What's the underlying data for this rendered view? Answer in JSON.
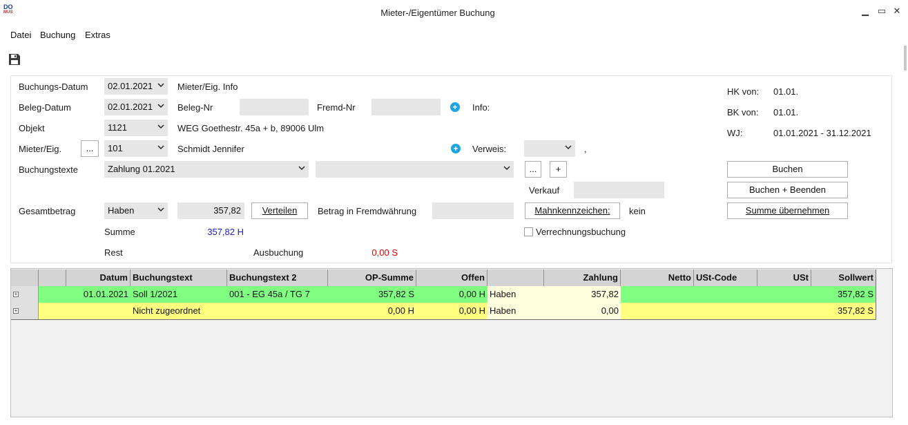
{
  "window": {
    "title": "Mieter-/Eigentümer Buchung",
    "logo_top": "DO",
    "logo_bottom": "MUS",
    "minimize": "▁",
    "maximize": "▭",
    "close": "✕"
  },
  "menu": {
    "datei": "Datei",
    "buchung": "Buchung",
    "extras": "Extras"
  },
  "form": {
    "buchungs_datum_label": "Buchungs-Datum",
    "buchungs_datum_value": "02.01.2021",
    "mieter_info_label": "Mieter/Eig. Info",
    "beleg_datum_label": "Beleg-Datum",
    "beleg_datum_value": "02.01.2021",
    "beleg_nr_label": "Beleg-Nr",
    "fremd_nr_label": "Fremd-Nr",
    "info_label": "Info:",
    "objekt_label": "Objekt",
    "objekt_value": "1121",
    "objekt_name": "WEG Goethestr. 45a + b, 89006 Ulm",
    "mieter_label": "Mieter/Eig.",
    "mieter_dots": "...",
    "mieter_value": "101",
    "mieter_name": "Schmidt Jennifer",
    "verweis_label": "Verweis:",
    "verweis_comma": ",",
    "buchungstexte_label": "Buchungstexte",
    "buchungstext1_value": "Zahlung 01.2021",
    "buchungstext2_value": "",
    "dots_button": "...",
    "plus_button": "+",
    "verkauf_label": "Verkauf",
    "gesamtbetrag_label": "Gesamtbetrag",
    "soll_haben_value": "Haben",
    "betrag_value": "357,82",
    "verteilen_button": "Verteilen",
    "fremdwaehrung_label": "Betrag in Fremdwährung",
    "mahnkennzeichen_button": "Mahnkennzeichen:",
    "mahnkennzeichen_value": "kein",
    "summe_label": "Summe",
    "summe_value": "357,82 H",
    "verrechnung_label": "Verrechnungsbuchung",
    "rest_label": "Rest",
    "ausbuchung_label": "Ausbuchung",
    "ausbuchung_value": "0,00 S"
  },
  "info_panel": {
    "hk_label": "HK von:",
    "hk_value": "01.01.",
    "bk_label": "BK von:",
    "bk_value": "01.01.",
    "wj_label": "WJ:",
    "wj_value": "01.01.2021 - 31.12.2021"
  },
  "actions": {
    "buchen": "Buchen",
    "buchen_beenden": "Buchen + Beenden",
    "summe_uebernehmen": "Summe übernehmen"
  },
  "grid": {
    "headers": [
      "Datum",
      "Buchungstext",
      "Buchungstext 2",
      "OP-Summe",
      "Offen",
      "",
      "Zahlung",
      "Netto",
      "USt-Code",
      "USt",
      "Sollwert"
    ],
    "rows": [
      {
        "datum": "01.01.2021",
        "text": "Soll 1/2021",
        "text2": "001 - EG  45a / TG 7",
        "op": "357,82 S",
        "offen": "0,00 H",
        "sh": "Haben",
        "zahlung": "357,82",
        "netto": "",
        "ustcode": "",
        "ust": "",
        "soll": "357,82 S"
      },
      {
        "datum": "",
        "text": "Nicht zugeordnet",
        "text2": "",
        "op": "0,00 H",
        "offen": "0,00 H",
        "sh": "Haben",
        "zahlung": "0,00",
        "netto": "",
        "ustcode": "",
        "ust": "",
        "soll": "357,82 S"
      }
    ]
  },
  "colors": {
    "row_green": "#80ff80",
    "row_yellow": "#ffff80",
    "input_cell": "#ffffe0",
    "summe_blue": "#1a1acc",
    "red": "#e00000",
    "accent": "#1ea4e0"
  }
}
